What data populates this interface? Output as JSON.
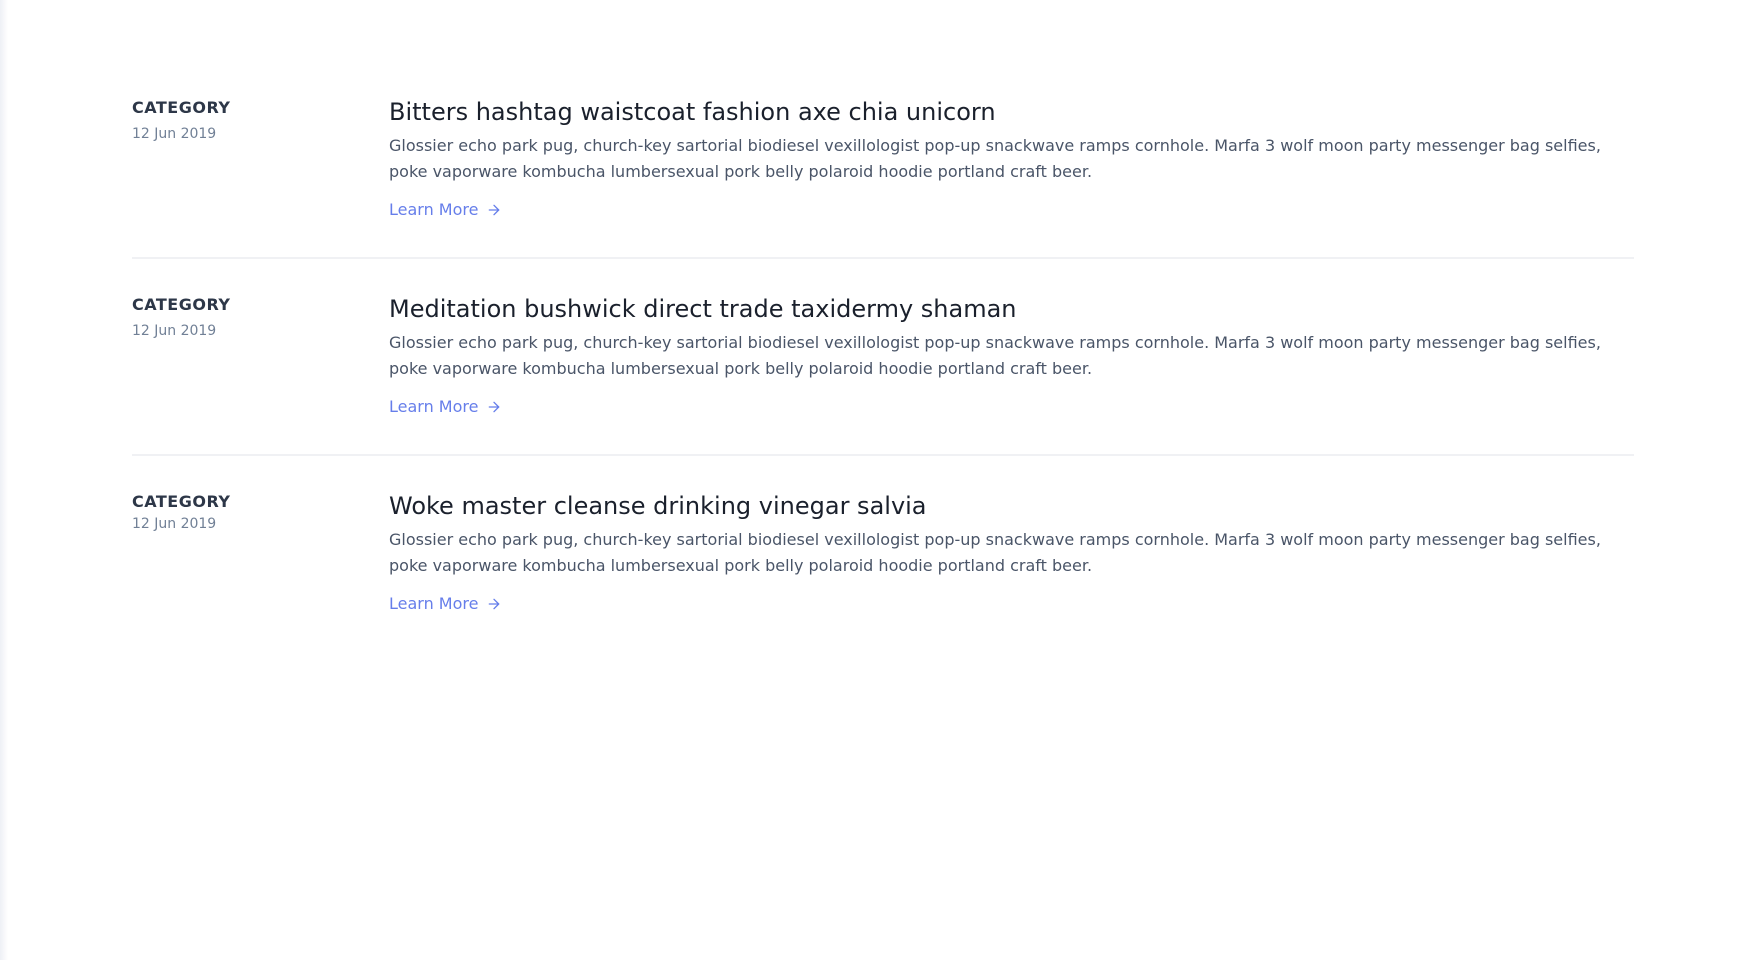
{
  "posts": [
    {
      "category": "CATEGORY",
      "date": "12 Jun 2019",
      "title": "Bitters hashtag waistcoat fashion axe chia unicorn",
      "description": "Glossier echo park pug, church-key sartorial biodiesel vexillologist pop-up snackwave ramps cornhole. Marfa 3 wolf moon party messenger bag selfies, poke vaporware kombucha lumbersexual pork belly polaroid hoodie portland craft beer.",
      "link_label": "Learn More",
      "link_icon": "arrow-right-icon"
    },
    {
      "category": "CATEGORY",
      "date": "12 Jun 2019",
      "title": "Meditation bushwick direct trade taxidermy shaman",
      "description": "Glossier echo park pug, church-key sartorial biodiesel vexillologist pop-up snackwave ramps cornhole. Marfa 3 wolf moon party messenger bag selfies, poke vaporware kombucha lumbersexual pork belly polaroid hoodie portland craft beer.",
      "link_label": "Learn More",
      "link_icon": "arrow-right-icon"
    },
    {
      "category": "CATEGORY",
      "date": "12 Jun 2019",
      "title": "Woke master cleanse drinking vinegar salvia",
      "description": "Glossier echo park pug, church-key sartorial biodiesel vexillologist pop-up snackwave ramps cornhole. Marfa 3 wolf moon party messenger bag selfies, poke vaporware kombucha lumbersexual pork belly polaroid hoodie portland craft beer.",
      "link_label": "Learn More",
      "link_icon": "arrow-right-icon"
    }
  ],
  "colors": {
    "accent": "#667eea",
    "title": "#1a202c",
    "category": "#2d3748",
    "body_text": "#4a5568",
    "muted": "#718096",
    "divider": "#f0f1f4"
  }
}
